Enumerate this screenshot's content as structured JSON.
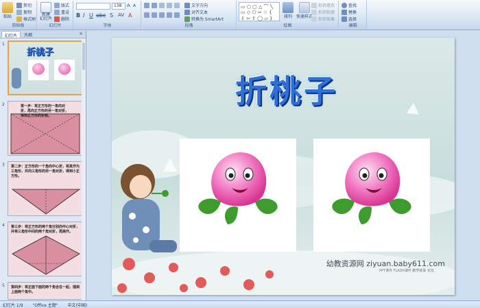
{
  "ribbon": {
    "clipboard": {
      "paste": "粘贴",
      "cut": "剪切",
      "copy": "复制",
      "format_painter": "格式刷",
      "label": "剪贴板"
    },
    "slides": {
      "new_slide": "新建\n幻灯片",
      "layout": "版式",
      "reset": "重设",
      "delete": "删除",
      "label": "幻灯片"
    },
    "font": {
      "font_size": "138",
      "label": "字体"
    },
    "paragraph": {
      "text_direction": "文字方向",
      "align_text": "对齐文本",
      "smartart": "转换为 SmartArt",
      "label": "段落"
    },
    "drawing": {
      "arrange": "排列",
      "quick_styles": "快速样式",
      "shape_fill": "形状填充",
      "shape_outline": "形状轮廓",
      "shape_effects": "形状效果",
      "label": "绘图"
    },
    "editing": {
      "find": "查找",
      "replace": "替换",
      "select": "选择",
      "label": "编辑"
    }
  },
  "left_panel": {
    "tabs": [
      "幻灯片",
      "大纲"
    ],
    "close": "×",
    "thumbnails": [
      {
        "num": "1",
        "text": "折桃子"
      },
      {
        "num": "2",
        "text": "第一步：将正方形的一角向对折，再向正方形的另一角对折，得到正方形的折痕。"
      },
      {
        "num": "3",
        "text": "第二步：正方形的一个角向中心折，将其作为三角形，并向三角形的另一角对折，得到小正方形。"
      },
      {
        "num": "4",
        "text": "第三步：将正方形的两个角分别向中心对折，并将三角形中间的两个角对折，再展开。"
      },
      {
        "num": "5",
        "text": "第四步：将正面下面的两个角合在一起，插到上面两个角中。"
      }
    ]
  },
  "slide": {
    "title": "折桃子",
    "watermark": "幼教资源网 ziyuan.baby611.com",
    "watermark_sub": "PPT课件 FLASH课件 教学故事 论坛"
  },
  "status": {
    "slide_count": "幻灯片 1/9",
    "theme": "\"Office 主题\"",
    "language": "中文(中国)"
  },
  "colors": {
    "ribbon_top": "#f6f9fd",
    "ribbon_bottom": "#c6d8ee",
    "title_blue": "#2f6fd8",
    "peach_pink": "#e84ea5",
    "leaf_green": "#3e9c2f",
    "selection_orange": "#f2a13a"
  }
}
